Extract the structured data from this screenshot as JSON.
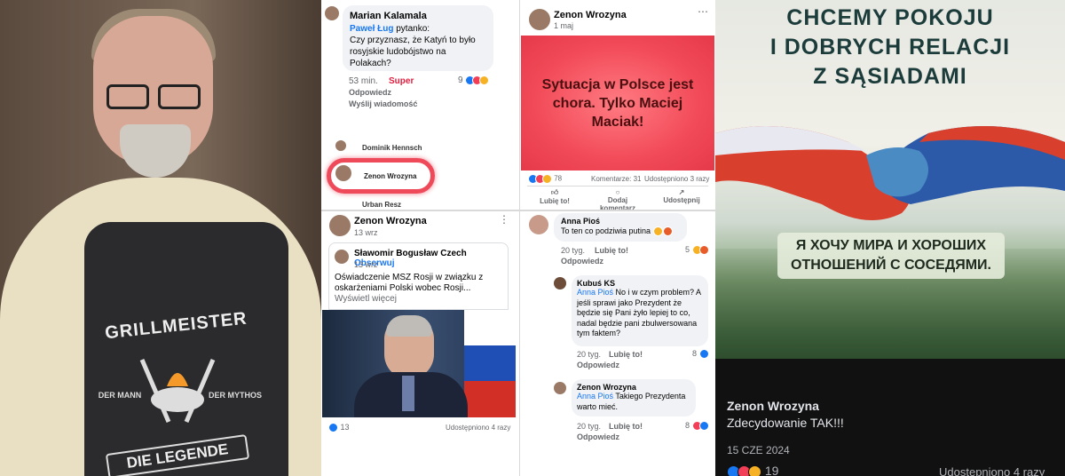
{
  "col2": {
    "comment1": {
      "author": "Marian Kalamala",
      "mention": "Paweł Ług",
      "text_after_mention": " pytanko:",
      "text": "Czy przyznasz, że Katyń to było rosyjskie  ludobójstwo na Polakach?",
      "time": "53 min.",
      "reaction_label": "Super",
      "reply": "Odpowiedz",
      "message": "Wyślij wiadomość",
      "count": "9"
    },
    "list": {
      "item1": "Dominik Hennsch",
      "item2": "Zenon Wrozyna",
      "item3": "Urban Resz"
    },
    "post": {
      "author": "Zenon Wrozyna",
      "date": "13 wrz",
      "shared_author": "Sławomir Bogusław Czech",
      "follow": "Obserwuj",
      "shared_date": "13 wrz",
      "text": "Oświadczenie MSZ Rosji w związku z oskarżeniami Polski wobec Rosji...",
      "see_more": " Wyświetl więcej",
      "reactions": "13",
      "shares": "Udostępniono 4 razy"
    }
  },
  "col3": {
    "post": {
      "author": "Zenon Wrozyna",
      "date": "1 maj",
      "image_text": "Sytuacja w Polsce jest chora. Tylko Maciej Maciak!",
      "reactions": "78",
      "comments": "Komentarze: 31",
      "shares": "Udostępniono 3 razy",
      "like": "Lubię to!",
      "comment": "Dodaj komentarz",
      "share": "Udostępnij"
    },
    "c1": {
      "author": "Anna Pioś",
      "text": "To ten co podziwia putina",
      "time": "20 tyg.",
      "like": "Lubię to!",
      "reply": "Odpowiedz",
      "count": "5"
    },
    "c2": {
      "author": "Kubuś KS",
      "mention": "Anna Pioś",
      "text": " No i w czym problem? A jeśli sprawi jako Prezydent że będzie się Pani żyło lepiej to co, nadal będzie pani zbulwersowana tym faktem?",
      "time": "20 tyg.",
      "like": "Lubię to!",
      "reply": "Odpowiedz",
      "count": "8"
    },
    "c3": {
      "author": "Zenon Wrozyna",
      "mention": "Anna Pioś",
      "text": " Takiego Prezydenta warto mieć.",
      "time": "20 tyg.",
      "like": "Lubię to!",
      "reply": "Odpowiedz",
      "count": "8"
    }
  },
  "col4": {
    "title_line1": "CHCEMY POKOJU",
    "title_line2": "I DOBRYCH RELACJI",
    "title_line3": "Z SĄSIADAMI",
    "ru_line1": "Я ХОЧУ МИРА И ХОРОШИХ",
    "ru_line2": "ОТНОШЕНИЙ С СОСЕДЯМИ.",
    "author": "Zenon Wrozyna",
    "text": "Zdecydowanie TAK!!!",
    "date": "15 CZE 2024",
    "reactions": "19",
    "shares": "Udostępniono 4 razy"
  },
  "photo": {
    "apron_title": "GRILLMEISTER",
    "apron_left": "DER MANN",
    "apron_right": "DER MYTHOS",
    "apron_banner": "DIE LEGENDE"
  },
  "colors": {
    "like": "#1877f2",
    "love": "#f33e58",
    "haha": "#f7b125",
    "super": "#e41e3f"
  }
}
